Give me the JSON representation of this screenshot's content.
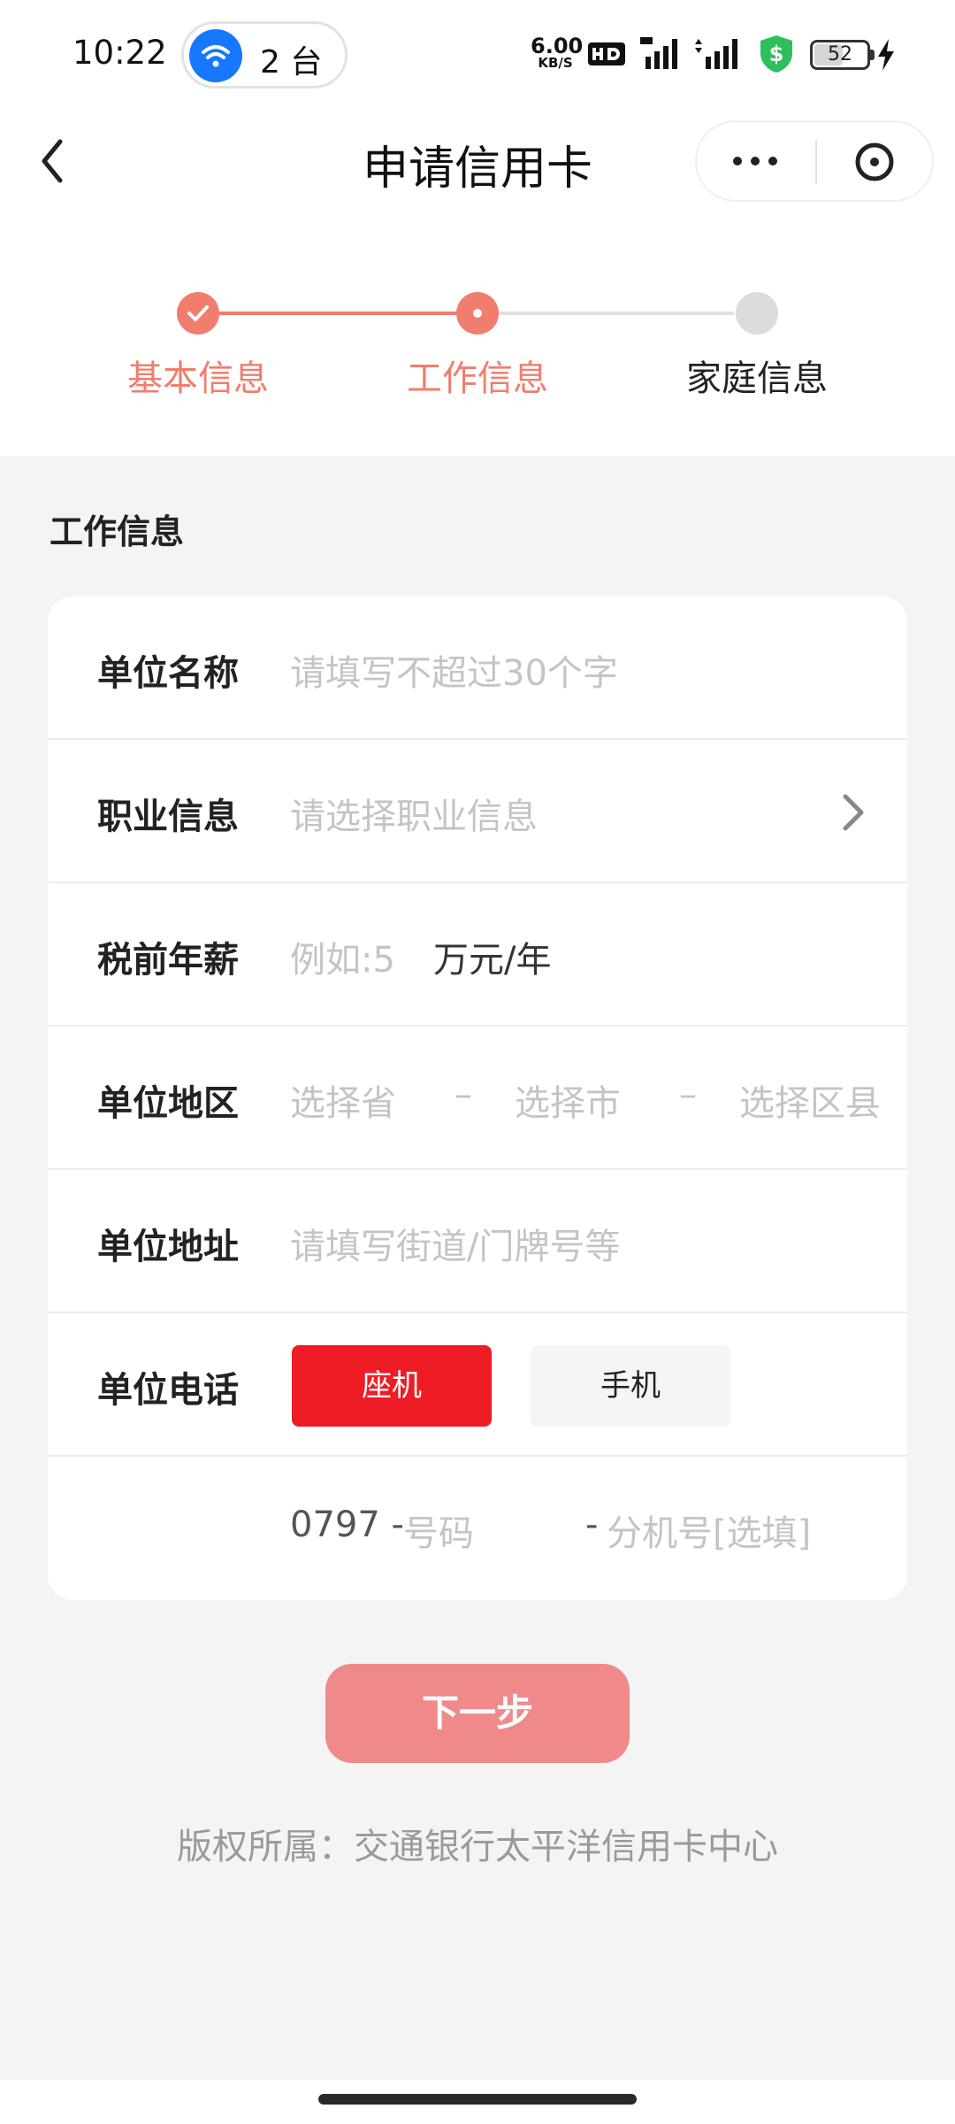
{
  "status_bar": {
    "time": "10:22",
    "wifi_devices": "2 台",
    "net_speed_value": "6.00",
    "net_speed_unit": "KB/S",
    "battery": "52"
  },
  "nav": {
    "title": "申请信用卡"
  },
  "stepper": {
    "steps": [
      {
        "label": "基本信息",
        "state": "done"
      },
      {
        "label": "工作信息",
        "state": "current"
      },
      {
        "label": "家庭信息",
        "state": "todo"
      }
    ],
    "accent_color": "#f07d6e"
  },
  "section": {
    "title": "工作信息"
  },
  "form": {
    "company_name": {
      "label": "单位名称",
      "placeholder": "请填写不超过30个字"
    },
    "occupation": {
      "label": "职业信息",
      "placeholder": "请选择职业信息"
    },
    "salary": {
      "label": "税前年薪",
      "placeholder": "例如:5",
      "unit": "万元/年"
    },
    "region": {
      "label": "单位地区",
      "province_placeholder": "选择省",
      "city_placeholder": "选择市",
      "district_placeholder": "选择区县",
      "separator": "–"
    },
    "address": {
      "label": "单位地址",
      "placeholder": "请填写街道/门牌号等"
    },
    "phone": {
      "label": "单位电话",
      "type_landline": "座机",
      "type_mobile": "手机",
      "area_code": "0797 -",
      "number_placeholder": "号码",
      "ext_prefix": "-",
      "ext_placeholder": "分机号[选填]"
    }
  },
  "actions": {
    "next_label": "下一步"
  },
  "footer": {
    "copyright": "版权所属：交通银行太平洋信用卡中心"
  },
  "colors": {
    "primary_red": "#ee1c25",
    "button_disabled": "#f08a8a"
  }
}
